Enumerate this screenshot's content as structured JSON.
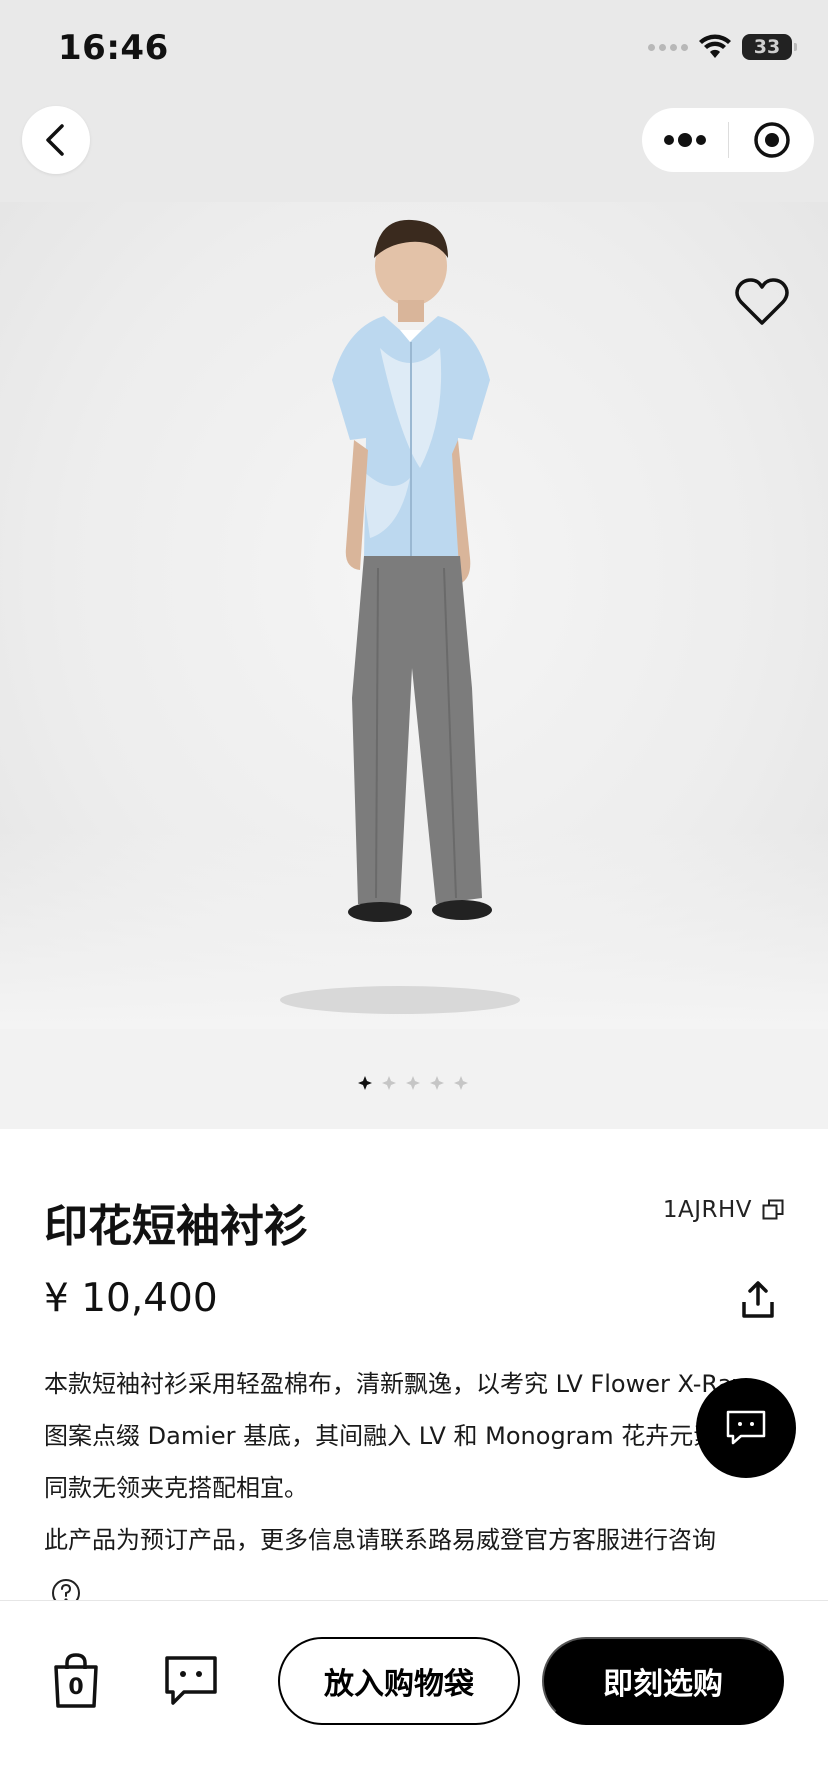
{
  "status_bar": {
    "time": "16:46",
    "battery": "33"
  },
  "nav": {
    "back_icon": "chevron-left-icon",
    "more_icon": "more-dots-icon",
    "close_icon": "target-circle-icon"
  },
  "gallery": {
    "image_count": 5,
    "active_index": 0,
    "favorite_icon": "heart-outline-icon"
  },
  "product": {
    "title": "印花短袖衬衫",
    "sku": "1AJRHV",
    "price": "¥ 10,400",
    "description_lines": [
      "本款短袖衬衫采用轻盈棉布，清新飘逸，以考究 LV Flower X-Ray",
      "图案点缀 Damier 基底，其间融入 LV 和 Monogram 花卉元素，",
      "同款无领夹克搭配相宜。",
      "此产品为预订产品，更多信息请联系路易威登官方客服进行咨询"
    ]
  },
  "bottom_bar": {
    "bag_count": "0",
    "add_to_bag": "放入购物袋",
    "buy_now": "即刻选购"
  },
  "colors": {
    "accent": "#000000",
    "background": "#ffffff",
    "image_bg": "#ededed"
  }
}
